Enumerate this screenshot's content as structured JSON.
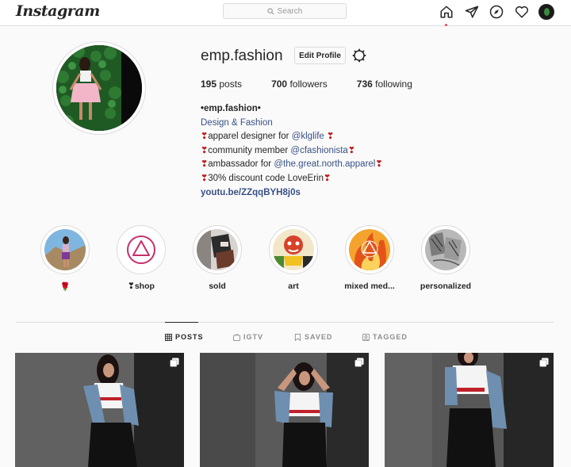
{
  "nav": {
    "logo": "Instagram",
    "search_placeholder": "Search"
  },
  "profile": {
    "username": "emp.fashion",
    "edit_button": "Edit Profile",
    "stats": {
      "posts_count": "195",
      "posts_label": "posts",
      "followers_count": "700",
      "followers_label": "followers",
      "following_count": "736",
      "following_label": "following"
    },
    "bio": {
      "name": "•emp.fashion•",
      "category": "Design & Fashion",
      "line1_prefix": "apparel designer for ",
      "line1_mention": "@klglife",
      "line2_prefix": "community member ",
      "line2_mention": "@cfashionista",
      "line3_prefix": "ambassador for ",
      "line3_mention": "@the.great.north.apparel",
      "line4_text": "30% discount code LoveErin",
      "link": "youtu.be/ZZqqBYH8j0s",
      "heart_glyph": "❣"
    }
  },
  "highlights": [
    {
      "label": "🌹"
    },
    {
      "label": "❣shop"
    },
    {
      "label": "sold"
    },
    {
      "label": "art"
    },
    {
      "label": "mixed med..."
    },
    {
      "label": "personalized"
    }
  ],
  "tabs": [
    {
      "label": "POSTS",
      "icon": "grid-icon",
      "active": true
    },
    {
      "label": "IGTV",
      "icon": "igtv-icon",
      "active": false
    },
    {
      "label": "SAVED",
      "icon": "bookmark-icon",
      "active": false
    },
    {
      "label": "TAGGED",
      "icon": "tag-icon",
      "active": false
    }
  ],
  "colors": {
    "link": "#385185",
    "heart": "#c0201f",
    "notification_dot": "#ed4956",
    "border": "#dbdbdb"
  }
}
